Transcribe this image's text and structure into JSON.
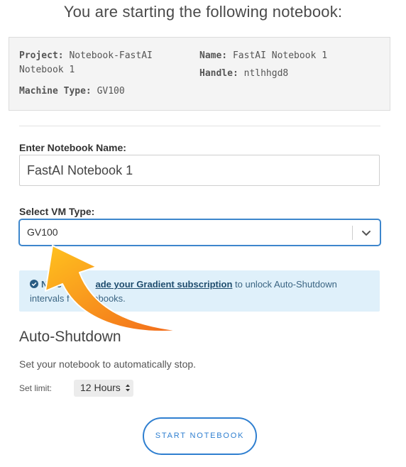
{
  "header": {
    "title": "You are starting the following notebook:"
  },
  "summary": {
    "project_label": "Project:",
    "project_value": "Notebook-FastAI Notebook 1",
    "name_label": "Name:",
    "name_value": "FastAI Notebook 1",
    "machine_label": "Machine Type:",
    "machine_value": "GV100",
    "handle_label": "Handle:",
    "handle_value": "ntlhhgd8"
  },
  "form": {
    "name_label": "Enter Notebook Name:",
    "name_value": "FastAI Notebook 1",
    "vm_label": "Select VM Type:",
    "vm_value": "GV100"
  },
  "notice": {
    "prefix": "Note",
    "link": "ade your Gradient subscription",
    "suffix": "to unlock Auto-Shutdown",
    "line2_start": "intervals f",
    "line2_end": "tebooks.",
    "icon": "check-circle-icon",
    "background_color": "#dff0fa"
  },
  "auto_shutdown": {
    "title": "Auto-Shutdown",
    "description": "Set your notebook to automatically stop.",
    "limit_label": "Set limit:",
    "limit_value": "12 Hours"
  },
  "actions": {
    "start_label": "START NOTEBOOK"
  },
  "colors": {
    "accent": "#2f7fd0",
    "arrow_start": "#ffc21f",
    "arrow_end": "#f26a1b"
  }
}
